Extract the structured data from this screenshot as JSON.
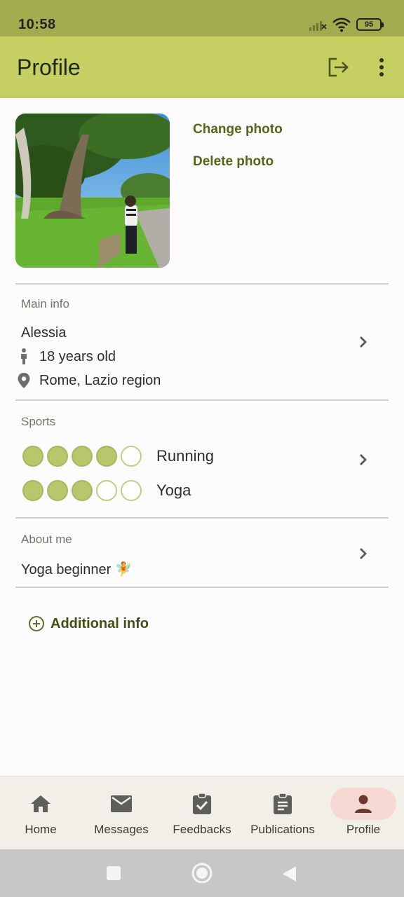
{
  "status_bar": {
    "time": "10:58",
    "battery": "95"
  },
  "app_bar": {
    "title": "Profile"
  },
  "photo_actions": {
    "change": "Change photo",
    "delete": "Delete photo"
  },
  "main_info": {
    "label": "Main info",
    "name": "Alessia",
    "age": "18 years old",
    "location": "Rome, Lazio region"
  },
  "sports": {
    "label": "Sports",
    "items": [
      {
        "name": "Running",
        "level": 4,
        "max": 5
      },
      {
        "name": "Yoga",
        "level": 3,
        "max": 5
      }
    ]
  },
  "about": {
    "label": "About me",
    "text": "Yoga beginner 🧚"
  },
  "additional": {
    "label": "Additional info"
  },
  "nav": {
    "items": [
      {
        "label": "Home",
        "icon": "home-icon"
      },
      {
        "label": "Messages",
        "icon": "mail-icon"
      },
      {
        "label": "Feedbacks",
        "icon": "clipboard-check-icon"
      },
      {
        "label": "Publications",
        "icon": "document-icon"
      },
      {
        "label": "Profile",
        "icon": "person-icon"
      }
    ],
    "active": "Profile"
  },
  "colors": {
    "status_bar": "#a2ac4f",
    "app_bar": "#c6cf61",
    "accent_text": "#55661c",
    "dot_filled": "#b8c76c",
    "nav_active": "#f6d9d2"
  }
}
